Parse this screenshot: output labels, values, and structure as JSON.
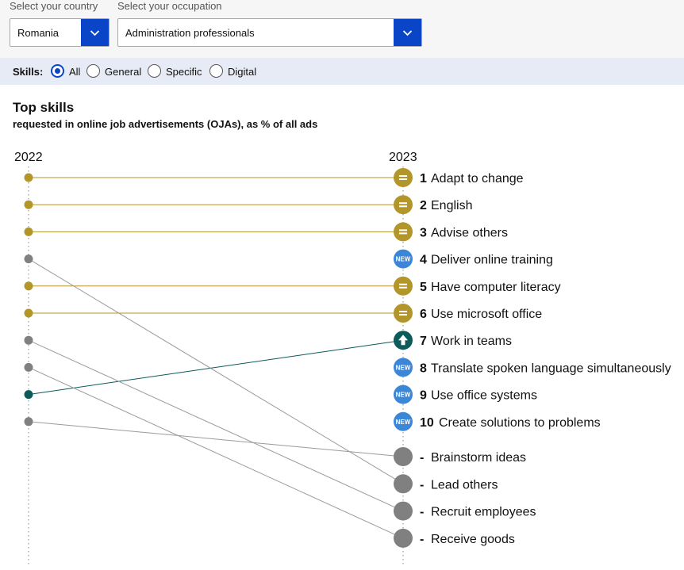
{
  "controls": {
    "country_label": "Select your country",
    "country_value": "Romania",
    "occupation_label": "Select your occupation",
    "occupation_value": "Administration professionals"
  },
  "skills_filter": {
    "label": "Skills:",
    "options": [
      "All",
      "General",
      "Specific",
      "Digital"
    ],
    "selected": "All"
  },
  "colors": {
    "same": "#b3962a",
    "new": "#3c86d8",
    "up": "#0c5a5a",
    "out": "#808080",
    "accent": "#0a45c7"
  },
  "chart_data": {
    "type": "slope",
    "title": "Top skills",
    "subtitle": "requested in online job advertisements (OJAs), as % of all ads",
    "year_left": "2022",
    "year_right": "2023",
    "new_badge_text": "NEW",
    "items": [
      {
        "rank": "1",
        "label": "Adapt to change",
        "status": "same",
        "rank_2022": 1
      },
      {
        "rank": "2",
        "label": "English",
        "status": "same",
        "rank_2022": 2
      },
      {
        "rank": "3",
        "label": "Advise others",
        "status": "same",
        "rank_2022": 3
      },
      {
        "rank": "4",
        "label": "Deliver online training",
        "status": "new",
        "rank_2022": null
      },
      {
        "rank": "5",
        "label": "Have computer literacy",
        "status": "same",
        "rank_2022": 5
      },
      {
        "rank": "6",
        "label": "Use microsoft office",
        "status": "same",
        "rank_2022": 6
      },
      {
        "rank": "7",
        "label": "Work in teams",
        "status": "up",
        "rank_2022": 9
      },
      {
        "rank": "8",
        "label": "Translate spoken language simultaneously",
        "status": "new",
        "rank_2022": null
      },
      {
        "rank": "9",
        "label": "Use office systems",
        "status": "new",
        "rank_2022": null
      },
      {
        "rank": "10",
        "label": "Create solutions to problems",
        "status": "new",
        "rank_2022": null
      },
      {
        "rank": "-",
        "label": "Brainstorm ideas",
        "status": "out",
        "rank_2022": 10
      },
      {
        "rank": "-",
        "label": "Lead others",
        "status": "out",
        "rank_2022": 4
      },
      {
        "rank": "-",
        "label": "Recruit employees",
        "status": "out",
        "rank_2022": 7
      },
      {
        "rank": "-",
        "label": "Receive goods",
        "status": "out",
        "rank_2022": 8
      }
    ]
  }
}
